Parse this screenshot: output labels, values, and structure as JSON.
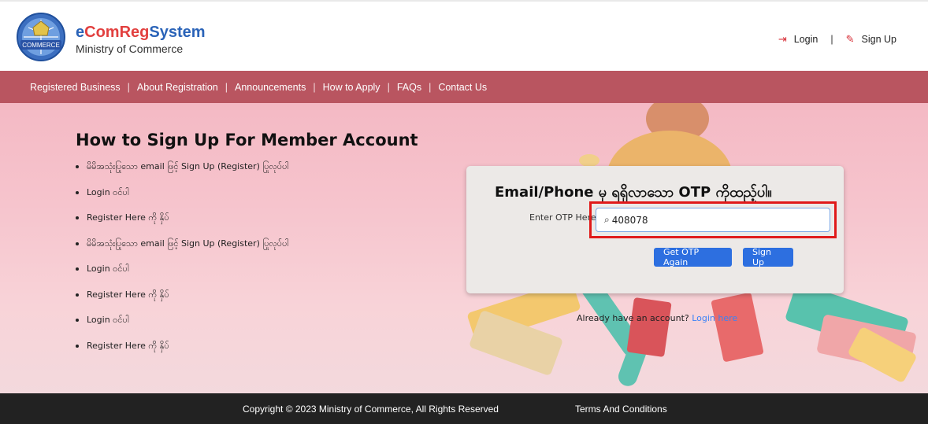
{
  "header": {
    "brand_part1": "e",
    "brand_part2": "ComReg",
    "brand_part3": "System",
    "ministry": "Ministry of Commerce",
    "logo_text": "COMMERCE",
    "login_label": "Login",
    "separator": "|",
    "signup_label": "Sign Up"
  },
  "nav": {
    "items": [
      {
        "label": "Registered Business"
      },
      {
        "label": "About Registration"
      },
      {
        "label": "Announcements"
      },
      {
        "label": "How to Apply"
      },
      {
        "label": "FAQs"
      },
      {
        "label": "Contact Us"
      }
    ],
    "separator": "|"
  },
  "howto": {
    "title": "How to Sign Up For Member Account",
    "steps": [
      "မိမိအသုံးပြုသော email ဖြင့် Sign Up (Register) ပြုလုပ်ပါ",
      "Login ဝင်ပါ",
      "Register Here ကို နှိပ်",
      "မိမိအသုံးပြုသော email ဖြင့် Sign Up (Register) ပြုလုပ်ပါ",
      "Login ဝင်ပါ",
      "Register Here ကို နှိပ်",
      "Login ဝင်ပါ",
      "Register Here ကို နှိပ်"
    ]
  },
  "otp": {
    "title": "Email/Phone မှ ရရှိလာသော OTP ကိုထည့်ပါ။",
    "label": "Enter OTP Here",
    "value": "408078",
    "get_otp_again": "Get OTP Again",
    "sign_up": "Sign Up"
  },
  "already": {
    "text": "Already have an account?",
    "link": "Login here"
  },
  "footer": {
    "copyright": "Copyright © 2023 Ministry of Commerce, All Rights Reserved",
    "terms": "Terms And Conditions"
  },
  "colors": {
    "nav_bg": "#b95560",
    "button": "#2d6fe0",
    "highlight_border": "#e01a1a",
    "footer_bg": "#222222"
  }
}
